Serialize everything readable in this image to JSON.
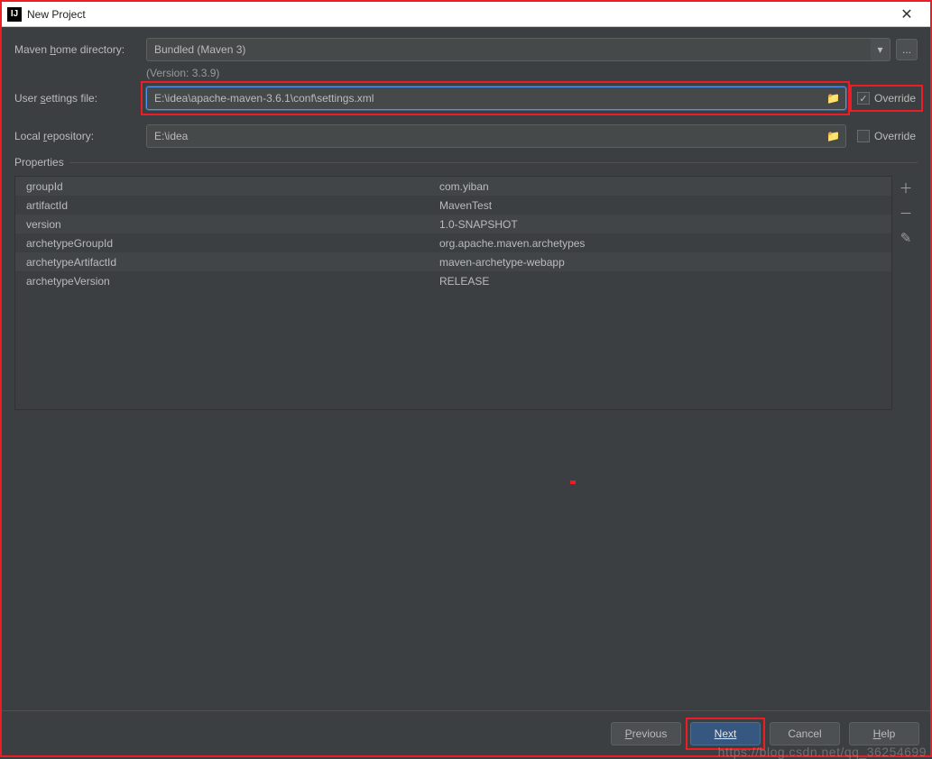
{
  "window": {
    "title": "New Project",
    "app_icon_label": "IJ"
  },
  "form": {
    "maven_home_label_pre": "Maven ",
    "maven_home_label_u": "h",
    "maven_home_label_post": "ome directory:",
    "maven_home_value": "Bundled (Maven 3)",
    "maven_version": "(Version: 3.3.9)",
    "user_settings_label_pre": "User ",
    "user_settings_label_u": "s",
    "user_settings_label_post": "ettings file:",
    "user_settings_value": "E:\\idea\\apache-maven-3.6.1\\conf\\settings.xml",
    "local_repo_label_pre": "Local ",
    "local_repo_label_u": "r",
    "local_repo_label_post": "epository:",
    "local_repo_value": "E:\\idea",
    "override_label": "Override"
  },
  "override": {
    "settings_checked": true,
    "repo_checked": false
  },
  "properties": {
    "legend": "Properties",
    "rows": [
      {
        "key": "groupId",
        "value": "com.yiban"
      },
      {
        "key": "artifactId",
        "value": "MavenTest"
      },
      {
        "key": "version",
        "value": "1.0-SNAPSHOT"
      },
      {
        "key": "archetypeGroupId",
        "value": "org.apache.maven.archetypes"
      },
      {
        "key": "archetypeArtifactId",
        "value": "maven-archetype-webapp"
      },
      {
        "key": "archetypeVersion",
        "value": "RELEASE"
      }
    ]
  },
  "buttons": {
    "previous_u": "P",
    "previous_post": "revious",
    "next_u": "N",
    "next_post": "ext",
    "cancel": "Cancel",
    "help_u": "H",
    "help_post": "elp"
  },
  "more_btn": "...",
  "watermark": "https://blog.csdn.net/qq_36254699"
}
